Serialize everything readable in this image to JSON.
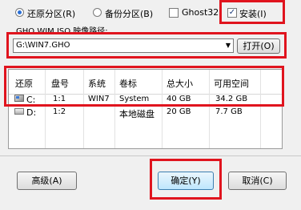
{
  "options": {
    "restore": "还原分区(R)",
    "backup": "备份分区(B)",
    "ghost32": "Ghost32",
    "install": "安装(I)"
  },
  "path": {
    "label": "GHO WIM ISO 映像路径:",
    "value": "G:\\WIN7.GHO",
    "open_button": "打开(O)"
  },
  "table": {
    "headers": [
      "还原",
      "盘号",
      "系统",
      "卷标",
      "总大小",
      "可用空间"
    ],
    "rows": [
      {
        "drive": "C:",
        "num": "1:1",
        "system": "WIN7",
        "label": "System",
        "total": "40 GB",
        "free": "34.2 GB"
      },
      {
        "drive": "D:",
        "num": "1:2",
        "system": "",
        "label": "本地磁盘",
        "total": "20 GB",
        "free": "7.7 GB"
      }
    ]
  },
  "buttons": {
    "advanced": "高级(A)",
    "ok": "确定(Y)",
    "cancel": "取消(C)"
  }
}
